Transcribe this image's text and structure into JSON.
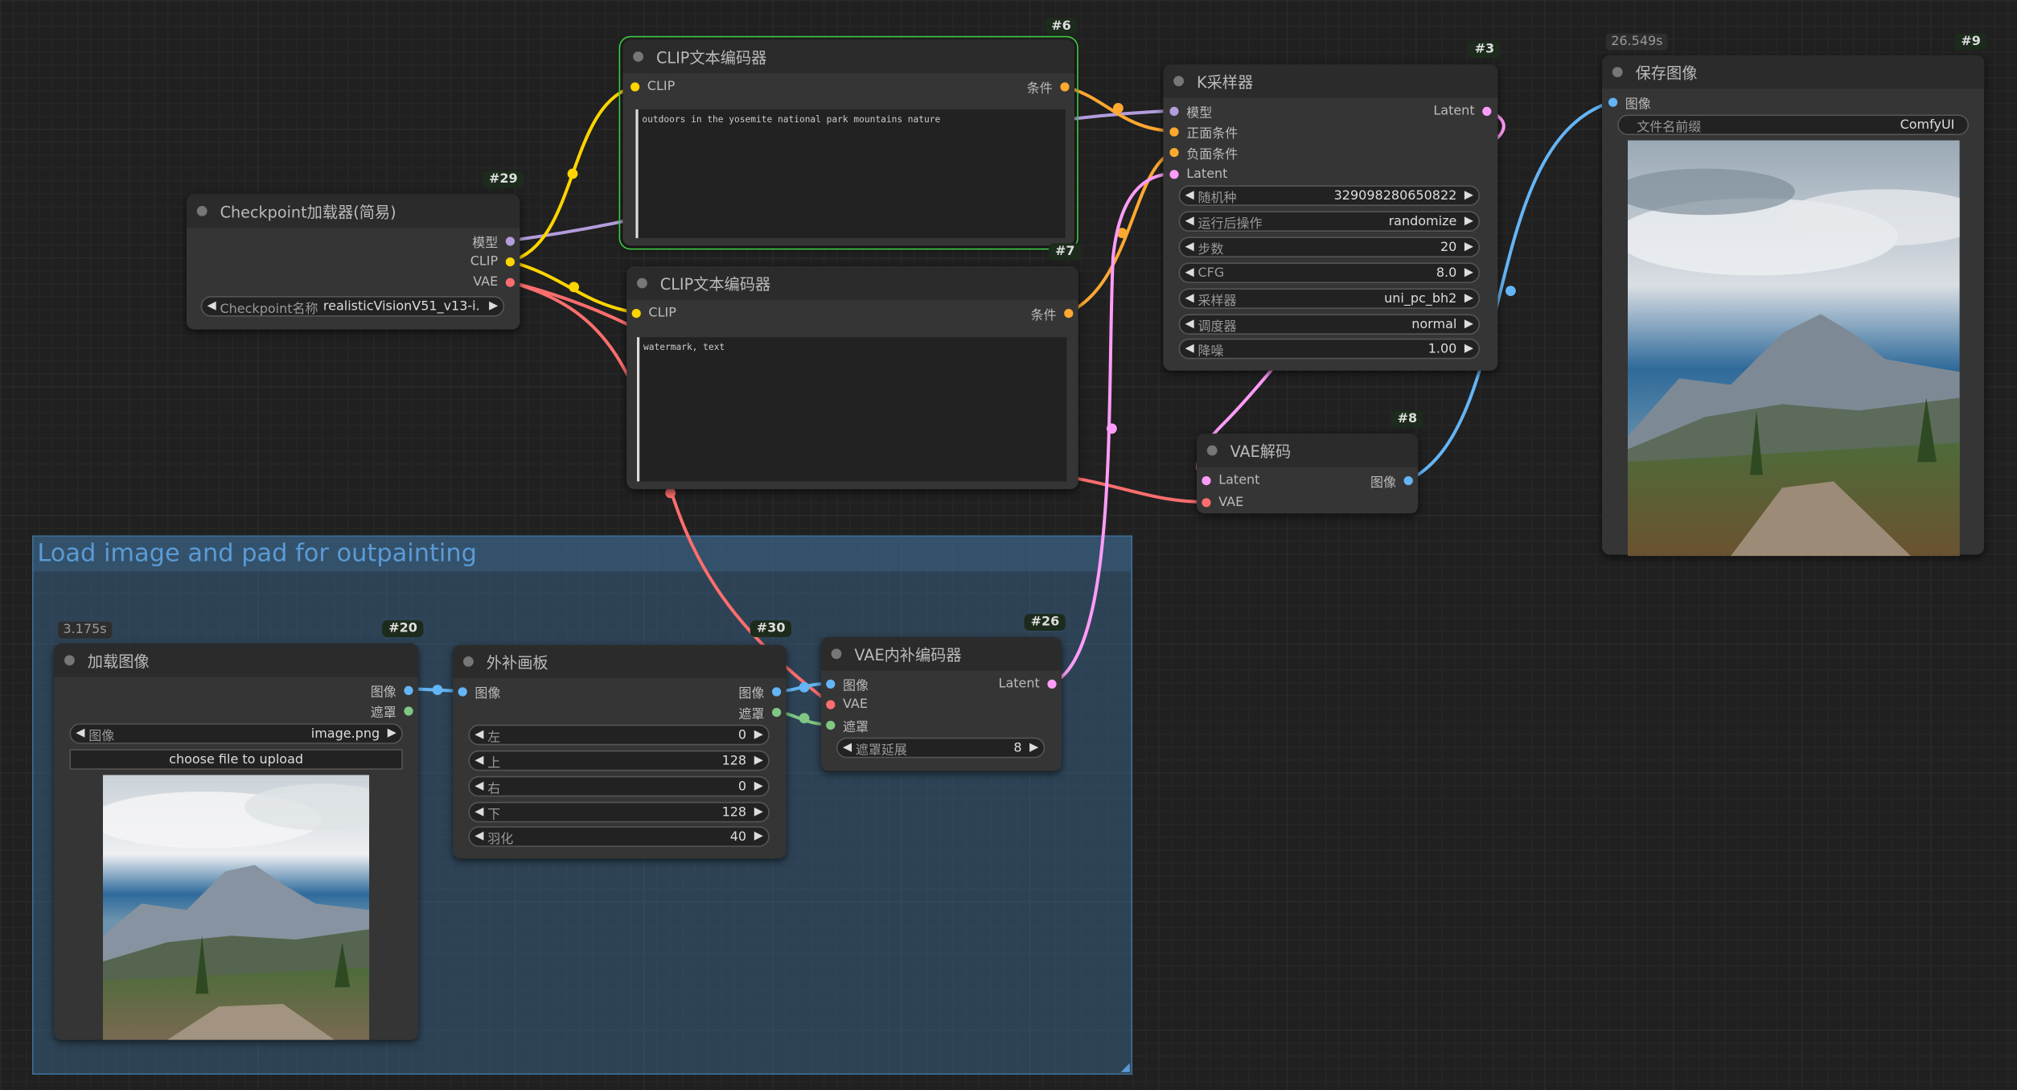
{
  "group": {
    "title": "Load image and pad for outpainting"
  },
  "nodes": {
    "checkpoint": {
      "title": "Checkpoint加载器(简易)",
      "id": "#29",
      "outputs": [
        "模型",
        "CLIP",
        "VAE"
      ],
      "widget_label": "Checkpoint名称",
      "widget_value": "realisticVisionV51_v13-i..."
    },
    "clip6": {
      "title": "CLIP文本编码器",
      "id": "#6",
      "input": "CLIP",
      "output": "条件",
      "text": "outdoors in the yosemite national park mountains nature"
    },
    "clip7": {
      "title": "CLIP文本编码器",
      "id": "#7",
      "input": "CLIP",
      "output": "条件",
      "text": "watermark, text"
    },
    "ksampler": {
      "title": "K采样器",
      "id": "#3",
      "inputs": [
        "模型",
        "正面条件",
        "负面条件",
        "Latent"
      ],
      "output": "Latent",
      "widgets": [
        {
          "label": "随机种",
          "value": "329098280650822"
        },
        {
          "label": "运行后操作",
          "value": "randomize"
        },
        {
          "label": "步数",
          "value": "20"
        },
        {
          "label": "CFG",
          "value": "8.0"
        },
        {
          "label": "采样器",
          "value": "uni_pc_bh2"
        },
        {
          "label": "调度器",
          "value": "normal"
        },
        {
          "label": "降噪",
          "value": "1.00"
        }
      ]
    },
    "vaedecode": {
      "title": "VAE解码",
      "id": "#8",
      "inputs": [
        "Latent",
        "VAE"
      ],
      "output": "图像"
    },
    "save": {
      "title": "保存图像",
      "id": "#9",
      "timer": "26.549s",
      "input": "图像",
      "widget_label": "文件名前缀",
      "widget_value": "ComfyUI"
    },
    "loadimage": {
      "title": "加载图像",
      "id": "#20",
      "timer": "3.175s",
      "outputs": [
        "图像",
        "遮罩"
      ],
      "widget_label": "图像",
      "widget_value": "image.png",
      "upload": "choose file to upload"
    },
    "pad": {
      "title": "外补画板",
      "id": "#30",
      "input": "图像",
      "outputs": [
        "图像",
        "遮罩"
      ],
      "widgets": [
        {
          "label": "左",
          "value": "0"
        },
        {
          "label": "上",
          "value": "128"
        },
        {
          "label": "右",
          "value": "0"
        },
        {
          "label": "下",
          "value": "128"
        },
        {
          "label": "羽化",
          "value": "40"
        }
      ]
    },
    "vaeencode": {
      "title": "VAE内补编码器",
      "id": "#26",
      "inputs": [
        "图像",
        "VAE",
        "遮罩"
      ],
      "output": "Latent",
      "widget_label": "遮罩延展",
      "widget_value": "8"
    }
  },
  "colors": {
    "model": "#b39ddb",
    "clip": "#ffd500",
    "vae": "#ff6e6e",
    "conditioning": "#ffa931",
    "latent": "#ff9cf9",
    "image": "#64b5f6",
    "mask": "#81c784",
    "selected": "#3dca43"
  },
  "icons": {
    "arrow_left": "◀",
    "arrow_right": "▶"
  }
}
